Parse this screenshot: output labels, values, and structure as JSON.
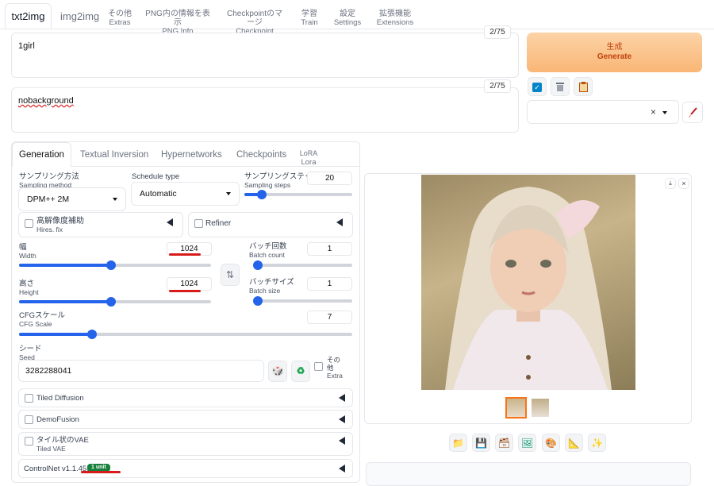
{
  "tabs": {
    "txt2img": "txt2img",
    "img2img": "img2img",
    "extras_jp": "その他",
    "extras_en": "Extras",
    "pnginfo_jp": "PNG内の情報を表示",
    "pnginfo_en": "PNG Info",
    "merger_jp": "Checkpointのマージ",
    "merger_en": "Checkpoint Merger",
    "train_jp": "学習",
    "train_en": "Train",
    "settings_jp": "設定",
    "settings_en": "Settings",
    "extensions_jp": "拡張機能",
    "extensions_en": "Extensions"
  },
  "prompt": {
    "value": "1girl",
    "counter": "2/75"
  },
  "negative": {
    "value": "nobackground",
    "counter": "2/75"
  },
  "generate": {
    "jp": "生成",
    "en": "Generate"
  },
  "style_select": {
    "clear": "×"
  },
  "subtabs": {
    "generation": "Generation",
    "textual_inversion": "Textual Inversion",
    "hypernetworks": "Hypernetworks",
    "checkpoints": "Checkpoints",
    "lora_jp": "LoRA",
    "lora_en": "Lora"
  },
  "sampling_method": {
    "jp": "サンプリング方法",
    "en": "Sampling method",
    "value": "DPM++ 2M"
  },
  "schedule_type": {
    "label": "Schedule type",
    "value": "Automatic"
  },
  "sampling_steps": {
    "jp": "サンプリングステップ数",
    "en": "Sampling steps",
    "value": "20",
    "fraction": 0.13
  },
  "hires": {
    "jp": "高解像度補助",
    "en": "Hires. fix"
  },
  "refiner": {
    "label": "Refiner"
  },
  "width": {
    "jp": "幅",
    "en": "Width",
    "value": "1024",
    "fraction": 0.48
  },
  "height": {
    "jp": "高さ",
    "en": "Height",
    "value": "1024",
    "fraction": 0.48
  },
  "swap_icon": "⇅",
  "batch_count": {
    "jp": "バッチ回数",
    "en": "Batch count",
    "value": "1",
    "fraction": 0.0
  },
  "batch_size": {
    "jp": "バッチサイズ",
    "en": "Batch size",
    "value": "1",
    "fraction": 0.0
  },
  "cfg": {
    "jp": "CFGスケール",
    "en": "CFG Scale",
    "value": "7",
    "fraction": 0.21
  },
  "seed": {
    "jp": "シード",
    "en": "Seed",
    "value": "3282288041"
  },
  "extra": {
    "jp": "その他",
    "en": "Extra"
  },
  "accordions": {
    "tiled_diffusion": "Tiled Diffusion",
    "demofusion": "DemoFusion",
    "tiled_vae_jp": "タイル状のVAE",
    "tiled_vae_en": "Tiled VAE",
    "controlnet": "ControlNet v1.1.455",
    "controlnet_badge": "1 unit"
  },
  "colors": {
    "accent": "#2563eb",
    "generate_bg": "#fbbf78",
    "generate_text": "#c2410c",
    "badge": "#16803c",
    "underline": "#d71a1a"
  },
  "icons": [
    "checkbox-icon",
    "trash-icon",
    "clipboard-icon",
    "brush-icon",
    "dice-icon",
    "recycle-icon",
    "folder-icon",
    "save-icon",
    "archive-icon",
    "image-icon",
    "palette-icon",
    "ruler-icon",
    "sparkle-icon",
    "download-icon",
    "close-icon"
  ]
}
